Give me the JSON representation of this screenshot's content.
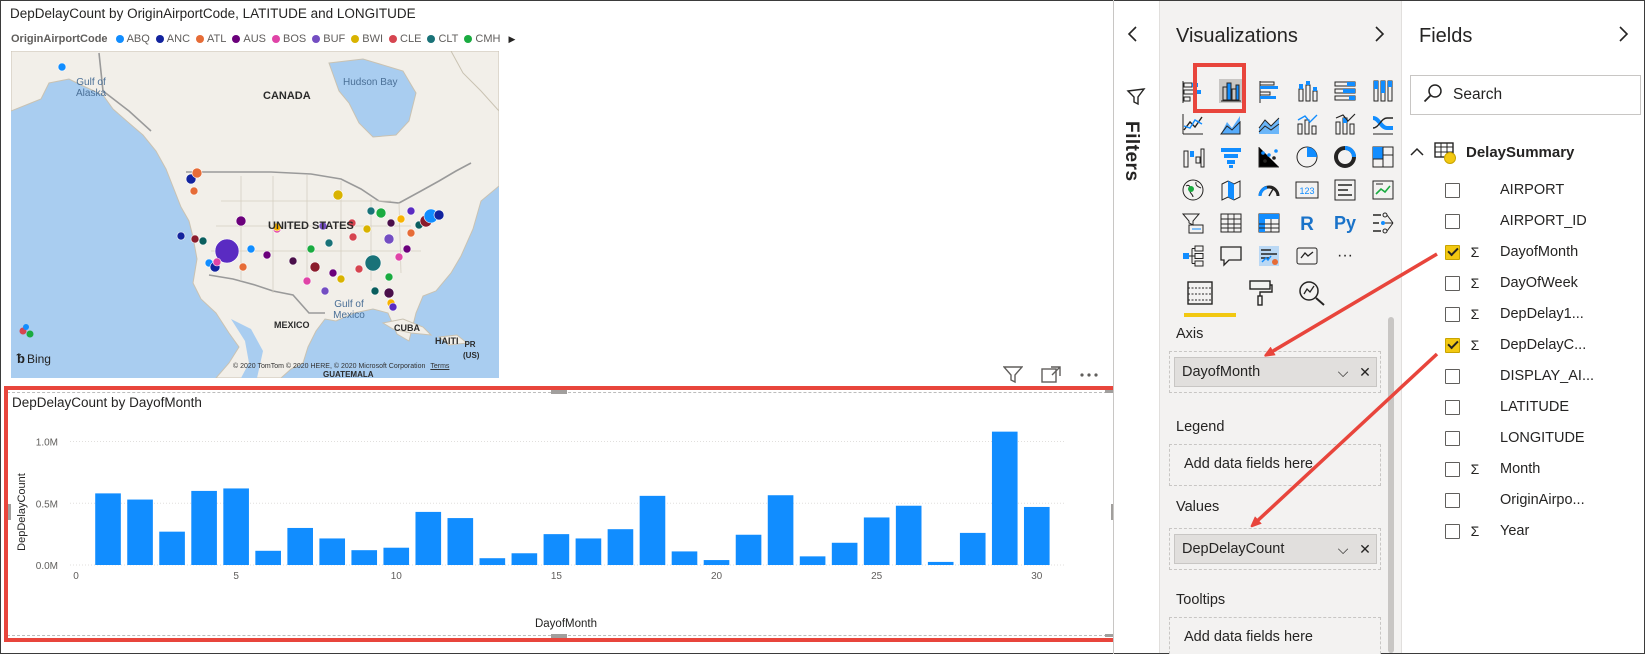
{
  "map_visual": {
    "title": "DepDelayCount by OriginAirportCode, LATITUDE and LONGITUDE",
    "legend_title": "OriginAirportCode",
    "legend_items": [
      {
        "label": "ABQ",
        "color": "#118dff"
      },
      {
        "label": "ANC",
        "color": "#12239e"
      },
      {
        "label": "ATL",
        "color": "#e66c37"
      },
      {
        "label": "AUS",
        "color": "#6b007b"
      },
      {
        "label": "BOS",
        "color": "#e044a7"
      },
      {
        "label": "BUF",
        "color": "#744ec2"
      },
      {
        "label": "BWI",
        "color": "#d9b300"
      },
      {
        "label": "CLE",
        "color": "#d64550"
      },
      {
        "label": "CLT",
        "color": "#197278"
      },
      {
        "label": "CMH",
        "color": "#1aab40"
      }
    ],
    "labels": {
      "canada": "CANADA",
      "us": "UNITED STATES",
      "mexico": "MEXICO",
      "cuba": "CUBA",
      "haiti": "HAITI",
      "guatemala": "GUATEMALA",
      "hudson": "Hudson Bay",
      "gulf_alaska": "Gulf of Alaska",
      "gulf_mexico": "Gulf of Mexico",
      "pr": "PR (US)"
    },
    "bing": "Bing",
    "copyright": "© 2020 TomTom © 2020 HERE, © 2020 Microsoft Corporation",
    "terms": "Terms"
  },
  "chart_data": {
    "type": "bar",
    "title": "DepDelayCount by DayofMonth",
    "xlabel": "DayofMonth",
    "ylabel": "DepDelayCount",
    "x": [
      1,
      2,
      3,
      4,
      5,
      6,
      7,
      8,
      9,
      10,
      11,
      12,
      13,
      14,
      15,
      16,
      17,
      18,
      19,
      20,
      21,
      22,
      23,
      24,
      25,
      26,
      27,
      28,
      29,
      30,
      31
    ],
    "values": [
      580000,
      530000,
      270000,
      600000,
      620000,
      115000,
      300000,
      215000,
      120000,
      140000,
      430000,
      380000,
      55000,
      95000,
      250000,
      215000,
      290000,
      560000,
      110000,
      40000,
      245000,
      565000,
      70000,
      180000,
      385000,
      480000,
      25000,
      260000,
      1080000,
      470000,
      0
    ],
    "ylim": [
      0,
      1150000
    ],
    "yticks": [
      {
        "value": 0,
        "label": "0.0M"
      },
      {
        "value": 500000,
        "label": "0.5M"
      },
      {
        "value": 1000000,
        "label": "1.0M"
      }
    ],
    "xticks": [
      {
        "value": 0,
        "label": "0"
      },
      {
        "value": 5,
        "label": "5"
      },
      {
        "value": 10,
        "label": "10"
      },
      {
        "value": 15,
        "label": "15"
      },
      {
        "value": 20,
        "label": "20"
      },
      {
        "value": 25,
        "label": "25"
      },
      {
        "value": 30,
        "label": "30"
      }
    ],
    "xlim": [
      0,
      30.6
    ],
    "bar_color": "#118dff",
    "grid": true
  },
  "filters": {
    "label": "Filters"
  },
  "visualizations": {
    "title": "Visualizations",
    "icons": [
      "stacked-bar-chart-icon",
      "clustered-column-chart-icon",
      "clustered-bar-chart-icon",
      "stacked-column-chart-icon",
      "100-stacked-bar-chart-icon",
      "100-stacked-column-chart-icon",
      "line-chart-icon",
      "area-chart-icon",
      "stacked-area-chart-icon",
      "line-and-column-chart-icon",
      "line-and-stacked-column-chart-icon",
      "ribbon-chart-icon",
      "waterfall-chart-icon",
      "funnel-chart-icon",
      "scatter-chart-icon",
      "pie-chart-icon",
      "donut-chart-icon",
      "treemap-icon",
      "map-icon",
      "filled-map-icon",
      "gauge-icon",
      "card-icon",
      "multi-row-card-icon",
      "kpi-icon",
      "slicer-icon",
      "table-icon",
      "matrix-icon",
      "r-visual-icon",
      "python-visual-icon",
      "key-influencers-icon",
      "decomposition-tree-icon",
      "qa-icon",
      "smart-narrative-icon",
      "paginated-report-icon",
      "more-visuals-icon"
    ],
    "r_label": "R",
    "py_label": "Py",
    "card_label": "123",
    "more_label": "···",
    "wells": {
      "axis": {
        "label": "Axis",
        "value": "DayofMonth"
      },
      "legend": {
        "label": "Legend",
        "placeholder": "Add data fields here"
      },
      "values": {
        "label": "Values",
        "value": "DepDelayCount"
      },
      "tooltips": {
        "label": "Tooltips",
        "placeholder": "Add data fields here"
      }
    }
  },
  "fields": {
    "title": "Fields",
    "search_placeholder": "Search",
    "table_name": "DelaySummary",
    "items": [
      {
        "name": "AIRPORT",
        "checked": false,
        "sigma": false
      },
      {
        "name": "AIRPORT_ID",
        "checked": false,
        "sigma": false
      },
      {
        "name": "DayofMonth",
        "checked": true,
        "sigma": true
      },
      {
        "name": "DayOfWeek",
        "checked": false,
        "sigma": true
      },
      {
        "name": "DepDelay1...",
        "checked": false,
        "sigma": true
      },
      {
        "name": "DepDelayC...",
        "checked": true,
        "sigma": true
      },
      {
        "name": "DISPLAY_AI...",
        "checked": false,
        "sigma": false
      },
      {
        "name": "LATITUDE",
        "checked": false,
        "sigma": false
      },
      {
        "name": "LONGITUDE",
        "checked": false,
        "sigma": false
      },
      {
        "name": "Month",
        "checked": false,
        "sigma": true
      },
      {
        "name": "OriginAirpo...",
        "checked": false,
        "sigma": false
      },
      {
        "name": "Year",
        "checked": false,
        "sigma": true
      }
    ]
  },
  "colors": {
    "accent_red": "#e8453c",
    "accent_yellow": "#f2c811",
    "bar_blue": "#118dff"
  }
}
